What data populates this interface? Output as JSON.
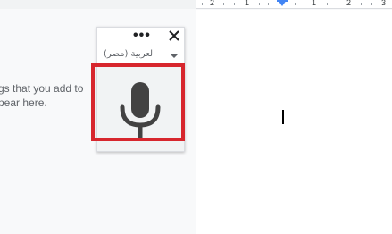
{
  "ruler": {
    "numbers": [
      "2",
      "1",
      "1",
      "2",
      "3"
    ],
    "marker_color": "#4285f4"
  },
  "left_panel": {
    "hint_line_1": "gs that you add to",
    "hint_line_2": "pear here."
  },
  "voice_typing": {
    "more_label": "•••",
    "close_icon": "close-icon",
    "language": "العربية (مصر)",
    "dropdown_icon": "caret-down-icon",
    "mic_icon": "microphone-icon",
    "highlight_color": "#d7262d"
  },
  "document": {
    "cursor_icon": "text-cursor"
  }
}
